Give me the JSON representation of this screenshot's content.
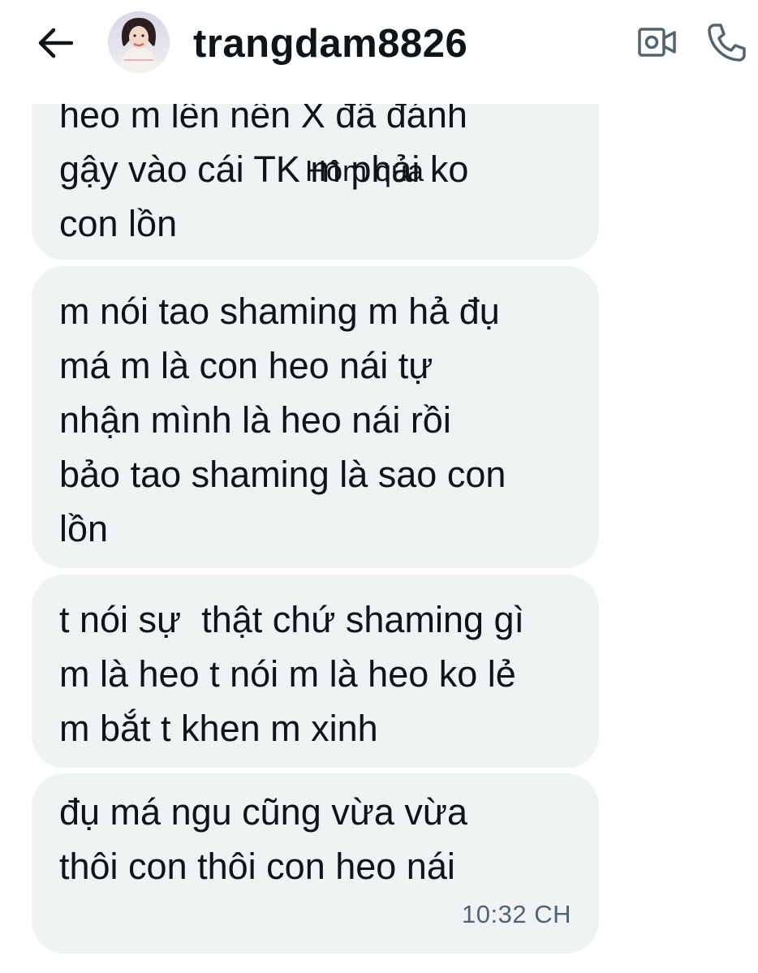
{
  "header": {
    "back_icon": "arrow-left-icon",
    "username": "trangdam8826",
    "video_icon": "video-camera-icon",
    "call_icon": "phone-icon"
  },
  "date_separator": "Hôm qua",
  "messages": [
    {
      "text": "heo m lên nên X đã đánh\ngậy vào cái TK m phải ko\ncon lồn"
    },
    {
      "text": "m nói tao shaming m hả đụ\nmá m là con heo nái tự\nnhận mình là heo nái rồi\nbảo tao shaming là sao con\nlồn"
    },
    {
      "text": "t nói sự  thật chứ shaming gì\nm là heo t nói m là heo ko lẻ\nm bắt t khen m xinh"
    },
    {
      "text": "đụ má ngu cũng vừa vừa\nthôi con thôi con heo nái",
      "timestamp": "10:32 CH"
    }
  ],
  "colors": {
    "bubble": "#eff3f4",
    "text": "#0f1419",
    "timestamp": "#536471"
  }
}
